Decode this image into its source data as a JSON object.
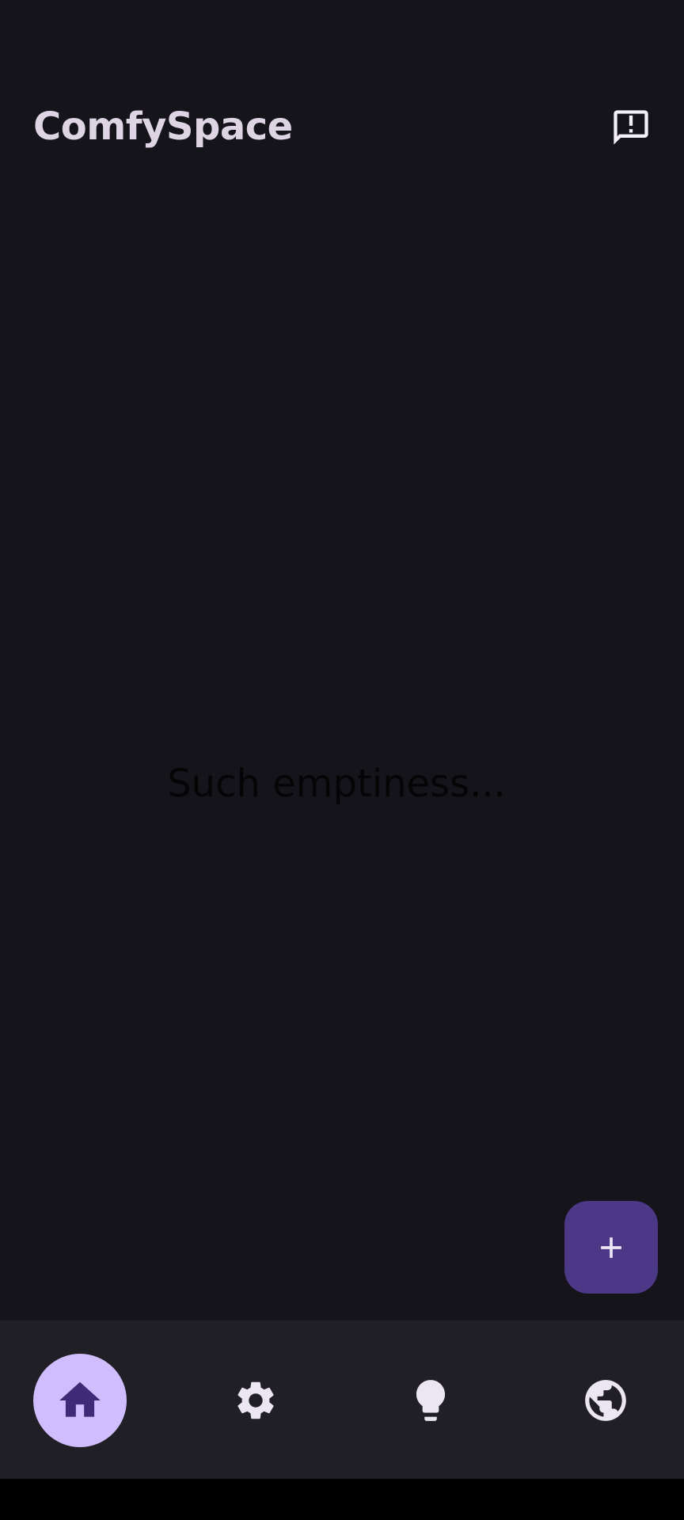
{
  "app": {
    "title": "ComfySpace"
  },
  "header": {
    "feedback_icon": "feedback-icon"
  },
  "main": {
    "empty_message": "Such emptiness..."
  },
  "fab": {
    "icon": "add-icon"
  },
  "bottom_nav": {
    "items": [
      {
        "id": "home",
        "icon": "home-icon",
        "active": true
      },
      {
        "id": "settings",
        "icon": "gear-icon",
        "active": false
      },
      {
        "id": "ideas",
        "icon": "lightbulb-icon",
        "active": false
      },
      {
        "id": "web",
        "icon": "globe-icon",
        "active": false
      }
    ]
  },
  "colors": {
    "background": "#16141b",
    "nav_background": "#211f26",
    "active_indicator": "#cfbdfd",
    "fab_background": "#4b3886",
    "title_text": "#ddd5e4",
    "icon_light": "#ece6f2",
    "active_icon": "#3e2b78"
  }
}
